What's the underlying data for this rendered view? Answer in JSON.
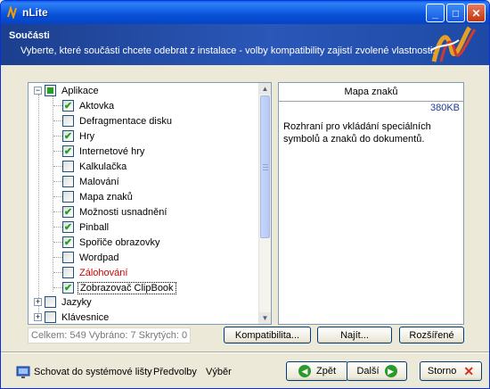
{
  "window": {
    "title": "nLite"
  },
  "header": {
    "title": "Součásti",
    "description": "Vyberte, které součásti chcete odebrat z instalace - volby kompatibility zajistí zvolené vlastnosti."
  },
  "tree": {
    "root": {
      "label": "Aplikace",
      "state": "partial",
      "expanded": true
    },
    "children": [
      {
        "label": "Aktovka",
        "checked": true
      },
      {
        "label": "Defragmentace disku",
        "checked": false
      },
      {
        "label": "Hry",
        "checked": true
      },
      {
        "label": "Internetové hry",
        "checked": true
      },
      {
        "label": "Kalkulačka",
        "checked": false
      },
      {
        "label": "Malování",
        "checked": false
      },
      {
        "label": "Mapa znaků",
        "checked": false
      },
      {
        "label": "Možnosti usnadnění",
        "checked": true
      },
      {
        "label": "Pinball",
        "checked": true
      },
      {
        "label": "Spořiče obrazovky",
        "checked": true
      },
      {
        "label": "Wordpad",
        "checked": false
      },
      {
        "label": "Zálohování",
        "checked": false,
        "red": true
      },
      {
        "label": "Zobrazovač ClipBook",
        "checked": true,
        "selected": true
      }
    ],
    "siblings": [
      {
        "label": "Jazyky",
        "checked": false
      },
      {
        "label": "Klávesnice",
        "checked": false
      }
    ]
  },
  "info": {
    "title": "Mapa znaků",
    "size": "380KB",
    "description": "Rozhraní pro vkládání speciálních symbolů a znaků do dokumentů."
  },
  "status": "Celkem: 549 Vybráno: 7 Skrytých: 0",
  "buttons": {
    "compat": "Kompatibilita...",
    "find": "Najít...",
    "advanced": "Rozšířené"
  },
  "footer": {
    "hide_tray": "Schovat do systémové lišty",
    "prefs": "Předvolby",
    "about": "Výběr",
    "back": "Zpět",
    "next": "Další",
    "cancel": "Storno"
  },
  "colors": {
    "accent": "#0851d8",
    "check": "#21a121",
    "warning": "#d00000"
  }
}
